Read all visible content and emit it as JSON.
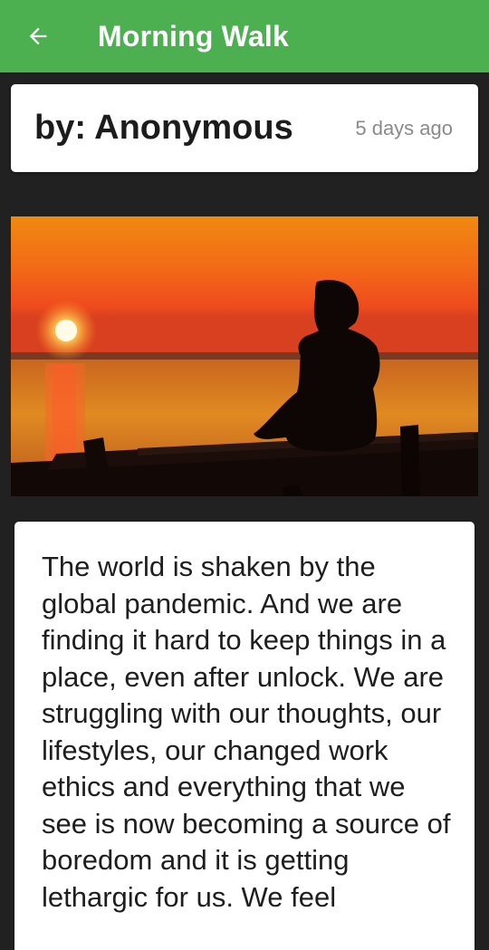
{
  "app_bar": {
    "title": "Morning Walk",
    "back_icon": "arrow-left-icon",
    "color": "#4CAF50"
  },
  "post": {
    "author_label": "by: Anonymous",
    "time_ago": "5 days ago",
    "image_description_icon": "sunset-silhouette-image",
    "story_text": "The world is shaken by the global pandemic. And we are finding it hard to keep things in a place, even after unlock. We are struggling with our thoughts, our lifestyles, our changed work ethics and everything that we see is now becoming a source of boredom and it is getting lethargic for us. We feel"
  }
}
